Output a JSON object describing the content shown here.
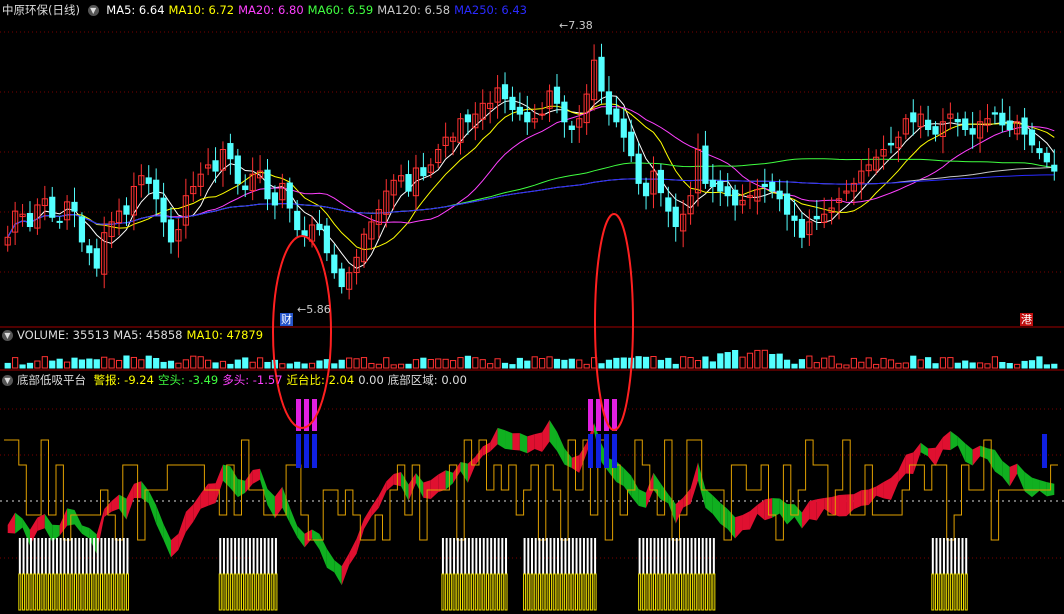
{
  "stock": {
    "name": "中原环保(日线)"
  },
  "price_panel": {
    "ma": [
      {
        "label": "MA5:",
        "value": "6.64",
        "color": "#ffffff"
      },
      {
        "label": "MA10:",
        "value": "6.72",
        "color": "#ffff00"
      },
      {
        "label": "MA20:",
        "value": "6.80",
        "color": "#ff40ff"
      },
      {
        "label": "MA60:",
        "value": "6.59",
        "color": "#40ff40"
      },
      {
        "label": "MA120:",
        "value": "6.58",
        "color": "#c8c8c8"
      },
      {
        "label": "MA250:",
        "value": "6.43",
        "color": "#2a2aff"
      }
    ],
    "high_label": "7.38",
    "low_label": "5.86",
    "mark_cai": "财",
    "mark_gang": "港"
  },
  "volume_panel": {
    "items": [
      {
        "label": "VOLUME:",
        "value": "35513",
        "color": "#dddddd"
      },
      {
        "label": "MA5:",
        "value": "45858",
        "color": "#dddddd"
      },
      {
        "label": "MA10:",
        "value": "47879",
        "color": "#ffff00"
      }
    ]
  },
  "indicator_panel": {
    "title": "底部低吸平台",
    "items": [
      {
        "label": "警报:",
        "value": "-9.24",
        "color": "#ffff00"
      },
      {
        "label": "空头:",
        "value": "-3.49",
        "color": "#40ff40"
      },
      {
        "label": "多头:",
        "value": "-1.57",
        "color": "#ff40ff"
      },
      {
        "label": "近台比:",
        "value": "2.04",
        "color": "#ffff00"
      },
      {
        "label": "",
        "value": "0.00",
        "color": "#dddddd"
      },
      {
        "label": "底部区域:",
        "value": "0.00",
        "color": "#dddddd"
      }
    ]
  },
  "chart_data": {
    "type": "candlestick",
    "ylim": [
      5.6,
      7.6
    ],
    "ma_labels": [
      "MA5",
      "MA10",
      "MA20",
      "MA60",
      "MA120",
      "MA250"
    ],
    "colors": {
      "up": "#ff3232",
      "down": "#54ffff",
      "grid": "#7a0000"
    },
    "closes": [
      6.15,
      6.32,
      6.3,
      6.22,
      6.36,
      6.4,
      6.28,
      6.25,
      6.38,
      6.32,
      6.12,
      6.05,
      5.95,
      6.18,
      6.25,
      6.32,
      6.3,
      6.48,
      6.55,
      6.5,
      6.4,
      6.25,
      6.12,
      6.2,
      6.42,
      6.48,
      6.56,
      6.62,
      6.58,
      6.72,
      6.66,
      6.5,
      6.46,
      6.56,
      6.58,
      6.4,
      6.36,
      6.5,
      6.34,
      6.2,
      6.16,
      6.23,
      6.2,
      6.05,
      5.92,
      5.83,
      5.92,
      6.02,
      6.17,
      6.25,
      6.33,
      6.45,
      6.52,
      6.55,
      6.45,
      6.6,
      6.55,
      6.62,
      6.72,
      6.8,
      6.8,
      6.92,
      6.9,
      6.95,
      7.02,
      7.02,
      7.12,
      7.05,
      6.98,
      6.95,
      6.9,
      6.92,
      6.95,
      7.1,
      7.02,
      6.9,
      6.85,
      6.92,
      7.08,
      7.3,
      7.1,
      6.95,
      6.9,
      6.8,
      6.68,
      6.5,
      6.42,
      6.58,
      6.44,
      6.32,
      6.22,
      6.3,
      6.42,
      6.72,
      6.5,
      6.48,
      6.45,
      6.42,
      6.36,
      6.39,
      6.42,
      6.46,
      6.48,
      6.45,
      6.4,
      6.3,
      6.26,
      6.15,
      6.25,
      6.27,
      6.3,
      6.34,
      6.4,
      6.45,
      6.5,
      6.58,
      6.62,
      6.67,
      6.72,
      6.75,
      6.8,
      6.92,
      6.9,
      6.95,
      6.85,
      6.82,
      6.9,
      6.95,
      6.9,
      6.85,
      6.82,
      6.9,
      6.92,
      6.95,
      6.88,
      6.85,
      6.9,
      6.82,
      6.75,
      6.7,
      6.64,
      6.58
    ]
  }
}
